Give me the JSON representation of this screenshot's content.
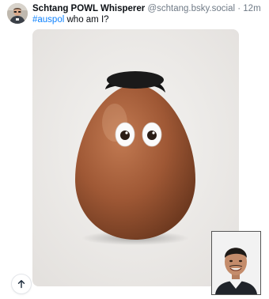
{
  "post": {
    "display_name": "Schtang POWL Whisperer",
    "handle": "@schtang.bsky.social",
    "separator": "·",
    "time": "12m",
    "hashtag": "#auspol",
    "text": " who am I?"
  },
  "icons": {
    "scroll_top": "arrow-up-icon"
  },
  "colors": {
    "link": "#1083fe",
    "muted": "#6f7a86",
    "egg": "#9a5533"
  }
}
